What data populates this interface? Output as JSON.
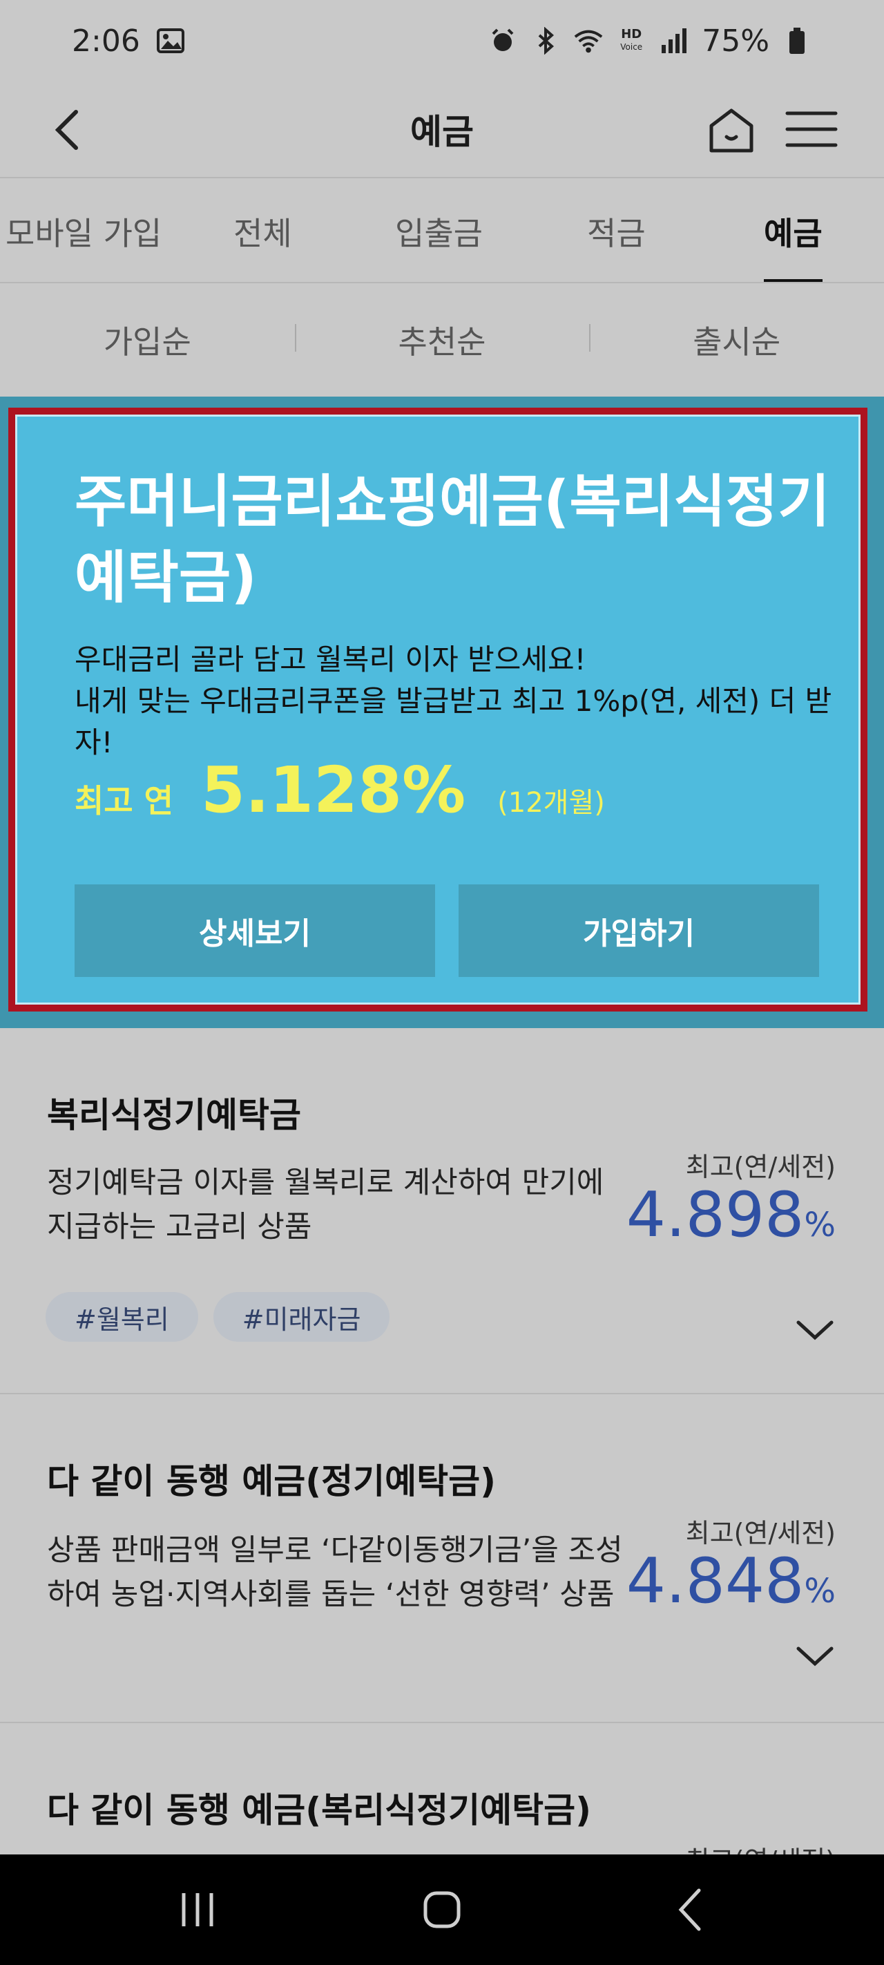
{
  "status": {
    "time": "2:06",
    "battery": "75%",
    "icons": [
      "gallery-icon",
      "alarm-icon",
      "bluetooth-icon",
      "wifi-icon",
      "hd-voice-icon",
      "signal-icon",
      "battery-icon"
    ],
    "hd_top": "HD",
    "hd_bottom": "Voice"
  },
  "header": {
    "title": "예금"
  },
  "tabs": [
    {
      "label": "모바일 가입"
    },
    {
      "label": "전체"
    },
    {
      "label": "입출금"
    },
    {
      "label": "적금"
    },
    {
      "label": "예금",
      "active": true
    }
  ],
  "sort": [
    {
      "label": "가입순"
    },
    {
      "label": "추천순"
    },
    {
      "label": "출시순"
    }
  ],
  "featured": {
    "title": "주머니금리쇼핑예금(복리식정기예탁금)",
    "desc_line1": "우대금리 골라 담고 월복리 이자 받으세요!",
    "desc_line2": "내게 맞는 우대금리쿠폰을 발급받고 최고 1%p(연, 세전) 더 받자!",
    "rate_label": "최고 연",
    "rate_value": "5.128%",
    "rate_term": "(12개월)",
    "detail_button": "상세보기",
    "join_button": "가입하기"
  },
  "products": [
    {
      "title": "복리식정기예탁금",
      "desc": "정기예탁금 이자를 월복리로 계산하여 만기에 지급하는 고금리 상품",
      "rate_label": "최고(연/세전)",
      "rate": "4.898",
      "pct": "%",
      "tags": [
        "#월복리",
        "#미래자금"
      ]
    },
    {
      "title": "다 같이 동행 예금(정기예탁금)",
      "desc": "상품 판매금액 일부로 ‘다같이동행기금’을 조성하여 농업·지역사회를 돕는 ‘선한 영향력’ 상품",
      "rate_label": "최고(연/세전)",
      "rate": "4.848",
      "pct": "%"
    },
    {
      "title": "다 같이 동행 예금(복리식정기예탁금)",
      "rate_label": "최고(연/세전)"
    }
  ],
  "colors": {
    "featured_bg": "#4fbbdd",
    "featured_outline": "#ad1320",
    "rate_blue": "#2f50a3",
    "rate_yellow": "#f4f25a"
  }
}
